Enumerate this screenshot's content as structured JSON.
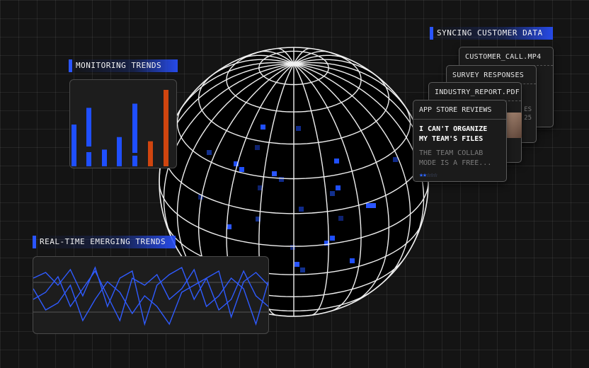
{
  "labels": {
    "monitoring": "MONITORING TRENDS",
    "emerging": "REAL-TIME EMERGING TRENDS",
    "syncing": "SYNCING CUSTOMER DATA"
  },
  "colors": {
    "accent": "#2a55ff",
    "bar_blue": "#1f4fff",
    "bar_orange": "#d0450f",
    "line": "#2f5bff"
  },
  "monitoring_bars": [
    0.5,
    0.7,
    0.2,
    0.35,
    0.75,
    0.3,
    0.85,
    0.95
  ],
  "cards": [
    {
      "title": "CUSTOMER_CALL.MP4"
    },
    {
      "title": "SURVEY RESPONSES"
    },
    {
      "title": "INDUSTRY_REPORT.PDF",
      "side_text": [
        "ES",
        "25"
      ]
    },
    {
      "head": "APP STORE REVIEWS",
      "title_lines": [
        "I CAN'T ORGANIZE",
        "MY TEAM'S FILES"
      ],
      "body_lines": [
        "THE TEAM COLLAB",
        "MODE IS A FREE..."
      ],
      "rating": 2,
      "rating_max": 5
    }
  ]
}
